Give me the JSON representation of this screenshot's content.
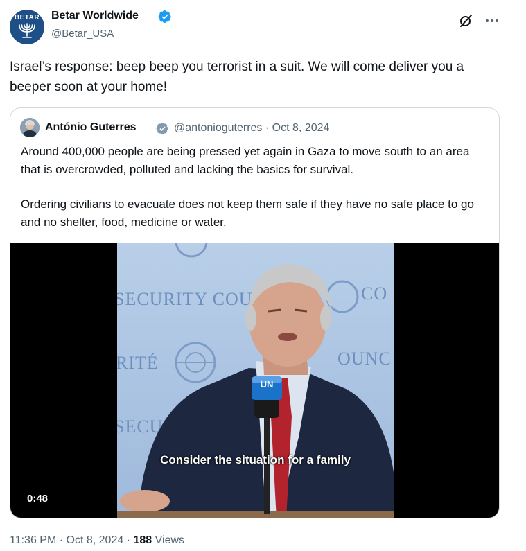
{
  "post": {
    "author_name": "Betar Worldwide",
    "author_handle": "@Betar_USA",
    "avatar_text": "BETAR",
    "text": "Israel’s response: beep beep you terrorist in a suit. We will come deliver you a beeper soon at your home!",
    "time": "11:36 PM",
    "separator": "·",
    "date": "Oct 8, 2024",
    "views_count": "188",
    "views_label": "Views"
  },
  "quoted": {
    "author_name": "António Guterres",
    "author_handle": "@antonioguterres",
    "separator": "·",
    "date": "Oct 8, 2024",
    "paragraph_1": "Around 400,000 people are being pressed yet again in Gaza to move south to an area that is overcrowded, polluted and lacking the basics for survival.",
    "paragraph_2": "Ordering civilians to evacuate does not keep them safe if they have no safe place to go and no shelter, food, medicine or water.",
    "video": {
      "duration": "0:48",
      "caption": "Consider the situation for a family",
      "backdrop_text_1": "SECURITY COU",
      "backdrop_text_2": "CO",
      "backdrop_text_3": "RITÉ",
      "backdrop_text_4": "OUNC",
      "backdrop_text_5": "SECUR",
      "mic_label": "UN"
    }
  },
  "icons": {
    "verified": "verified-badge-icon",
    "grok": "grok-icon",
    "more": "more-options-icon"
  },
  "colors": {
    "accent": "#1d9bf0",
    "secondary_text": "#536471",
    "primary_text": "#0f1419",
    "border": "#cfd9de",
    "verified_quoted": "#829aab"
  }
}
